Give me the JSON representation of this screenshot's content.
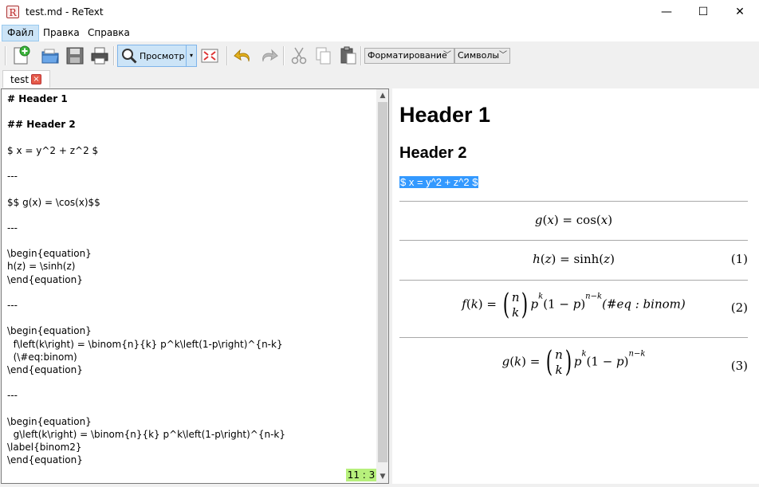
{
  "window": {
    "title": "test.md - ReText",
    "icon_letter": "R",
    "minimize": "—",
    "maximize": "☐",
    "close": "✕"
  },
  "menu": [
    "Файл",
    "Правка",
    "Справка"
  ],
  "toolbar": {
    "preview_label": "Просмотр",
    "formatting_label": "Форматирование",
    "symbols_label": "Символы",
    "dropdown_arrow": "▾"
  },
  "tab": {
    "label": "test",
    "close": "×"
  },
  "editor": {
    "lines": [
      "# Header 1",
      "",
      "## Header 2",
      "",
      "$ x = y^2 + z^2 $",
      "",
      "---",
      "",
      "$$ g(x) = \\cos(x)$$",
      "",
      "---",
      "",
      "\\begin{equation}",
      "h(z) = \\sinh(z)",
      "\\end{equation}",
      "",
      "---",
      "",
      "\\begin{equation}",
      "  f\\left(k\\right) = \\binom{n}{k} p^k\\left(1-p\\right)^{n-k}",
      "  (\\#eq:binom)",
      "\\end{equation}",
      "",
      "---",
      "",
      "\\begin{equation}",
      "  g\\left(k\\right) = \\binom{n}{k} p^k\\left(1-p\\right)^{n-k}",
      "\\label{binom2}",
      "\\end{equation}"
    ],
    "cursor_position": "11 : 3",
    "scroll_up": "▲",
    "scroll_down": "▼"
  },
  "preview": {
    "h1": "Header 1",
    "h2": "Header 2",
    "inline_math": "$ x = y^2 + z^2 $",
    "eq_g_cos": {
      "lhs": "g",
      "var": "x",
      "rhs_fn": "cos"
    },
    "eq_h": {
      "lhs": "h",
      "var": "z",
      "rhs_fn": "sinh",
      "number": "(1)"
    },
    "eq_f": {
      "lhs": "f",
      "var": "k",
      "binom_top": "n",
      "binom_bottom": "k",
      "p": "p",
      "exp1": "k",
      "exp2": "n−k",
      "tag": "(#eq : binom)",
      "number": "(2)"
    },
    "eq_g": {
      "lhs": "g",
      "var": "k",
      "binom_top": "n",
      "binom_bottom": "k",
      "p": "p",
      "exp1": "k",
      "exp2": "n−k",
      "number": "(3)"
    }
  }
}
